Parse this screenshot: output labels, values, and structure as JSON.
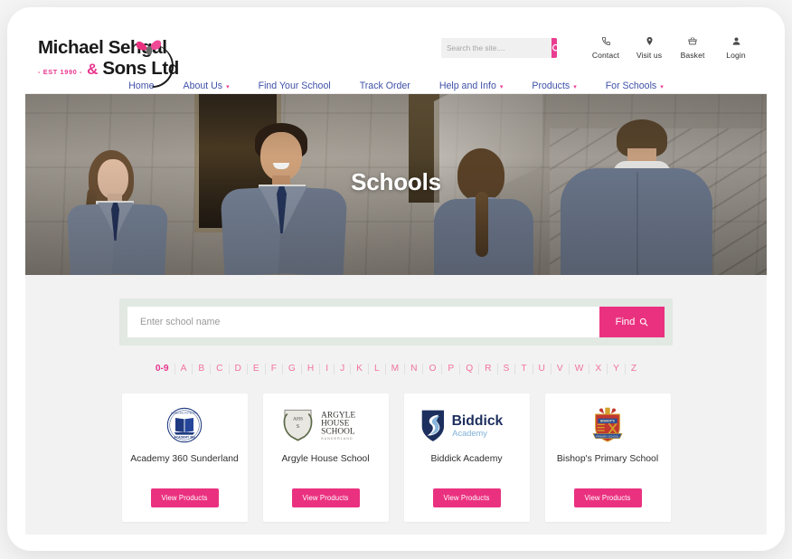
{
  "brand": {
    "name_line1": "Michael Sehgal",
    "name_line2": "& Sons Ltd",
    "established": "- EST 1990 -",
    "accent_color": "#ea3180",
    "nav_color": "#3f51a8"
  },
  "header": {
    "search": {
      "placeholder": "Search the site....",
      "value": "",
      "icon": "search-icon"
    },
    "utilities": [
      {
        "label": "Contact",
        "icon": "phone-icon"
      },
      {
        "label": "Visit us",
        "icon": "map-pin-icon"
      },
      {
        "label": "Basket",
        "icon": "basket-icon"
      },
      {
        "label": "Login",
        "icon": "user-icon"
      }
    ],
    "nav": [
      {
        "label": "Home",
        "has_dropdown": false
      },
      {
        "label": "About Us",
        "has_dropdown": true
      },
      {
        "label": "Find Your School",
        "has_dropdown": false
      },
      {
        "label": "Track Order",
        "has_dropdown": false
      },
      {
        "label": "Help and Info",
        "has_dropdown": true
      },
      {
        "label": "Products",
        "has_dropdown": true
      },
      {
        "label": "For Schools",
        "has_dropdown": true
      }
    ],
    "caret": "⌵"
  },
  "hero": {
    "title": "Schools"
  },
  "finder": {
    "placeholder": "Enter school name",
    "value": "",
    "button_label": "Find",
    "button_icon": "search-icon"
  },
  "alphabet": {
    "items": [
      "0-9",
      "A",
      "B",
      "C",
      "D",
      "E",
      "F",
      "G",
      "H",
      "I",
      "J",
      "K",
      "L",
      "M",
      "N",
      "O",
      "P",
      "Q",
      "R",
      "S",
      "T",
      "U",
      "V",
      "W",
      "X",
      "Y",
      "Z"
    ],
    "active": "0-9"
  },
  "schools": [
    {
      "name": "Academy 360 Sunderland",
      "logo": "academy-360-crest",
      "button_label": "View Products"
    },
    {
      "name": "Argyle House School",
      "logo": "argyle-house-crest",
      "button_label": "View Products"
    },
    {
      "name": "Biddick Academy",
      "logo": "biddick-academy-shield",
      "button_label": "View Products"
    },
    {
      "name": "Bishop's Primary School",
      "logo": "bishops-primary-crest",
      "button_label": "View Products"
    }
  ]
}
